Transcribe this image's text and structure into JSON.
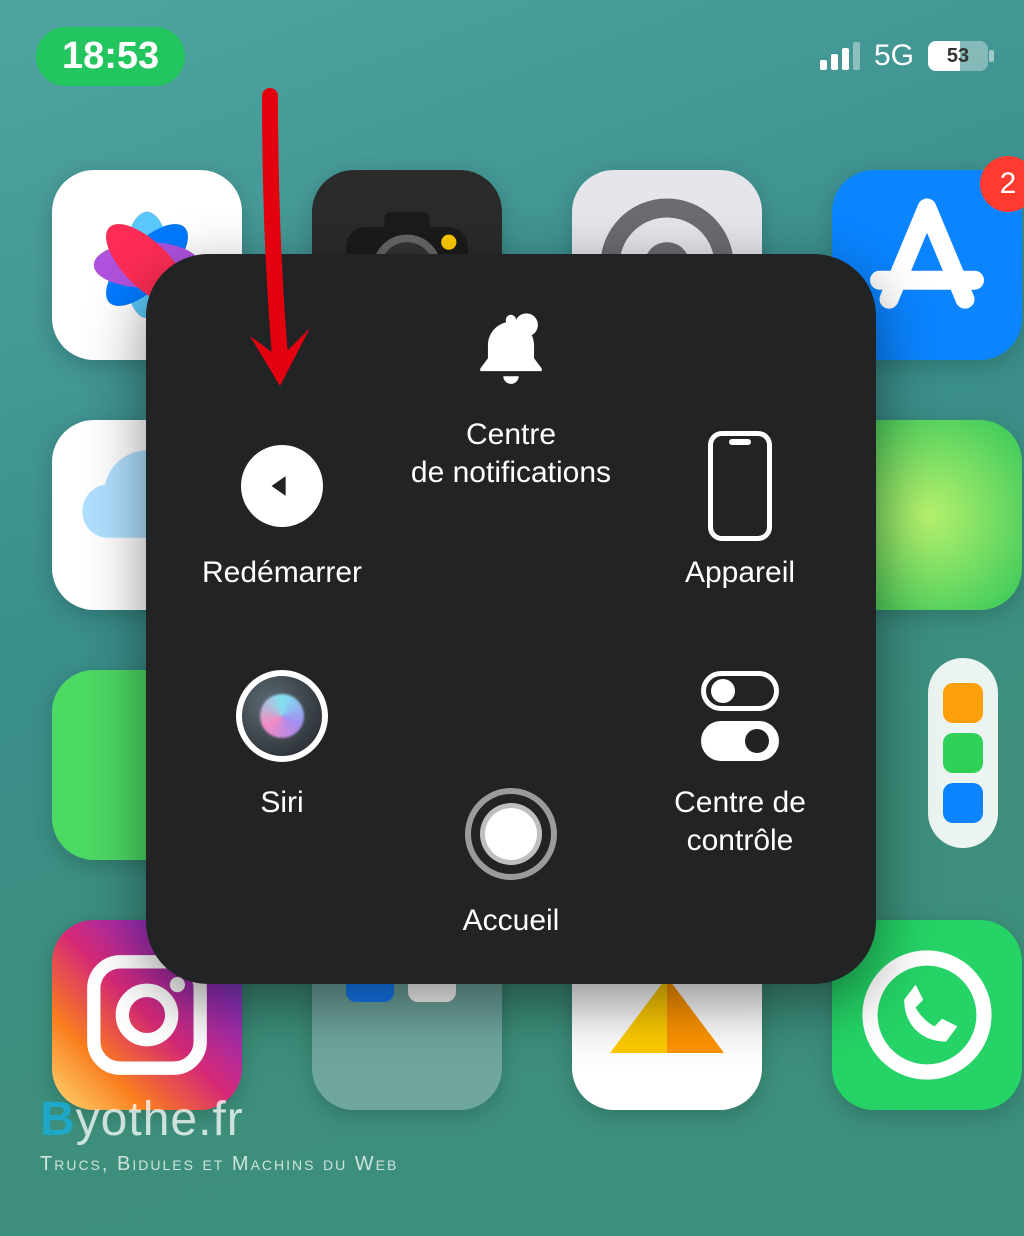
{
  "status": {
    "time": "18:53",
    "network": "5G",
    "battery_pct": "53"
  },
  "badge": {
    "appstore": "2"
  },
  "panel": {
    "notifications": "Centre\nde notifications",
    "restart": "Redémarrer",
    "device": "Appareil",
    "siri": "Siri",
    "control_center": "Centre de\ncontrôle",
    "home": "Accueil"
  },
  "watermark": {
    "brand_prefix": "B",
    "brand_rest": "yothe.fr",
    "tagline": "Trucs, Bidules et Machins du Web"
  }
}
